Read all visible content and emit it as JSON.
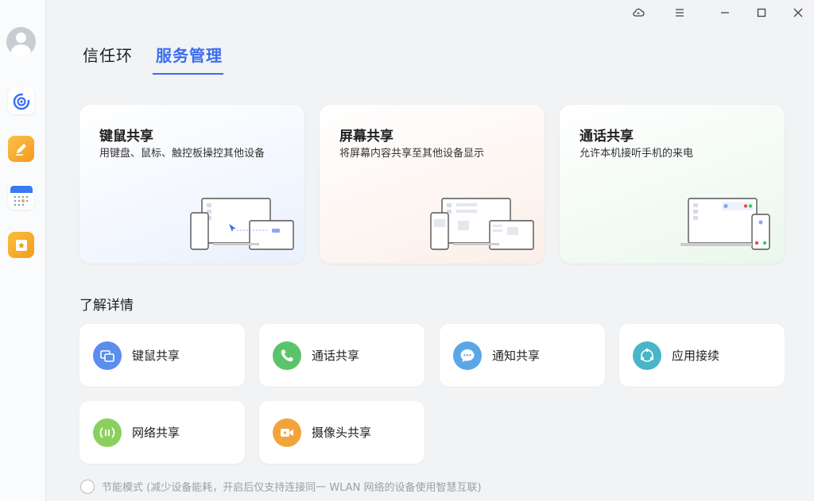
{
  "tabs": [
    {
      "label": "信任环",
      "active": false
    },
    {
      "label": "服务管理",
      "active": true
    }
  ],
  "feature_cards": [
    {
      "title": "键鼠共享",
      "desc": "用键盘、鼠标、触控板操控其他设备",
      "bg": "#eaf1fd"
    },
    {
      "title": "屏幕共享",
      "desc": "将屏幕内容共享至其他设备显示",
      "bg": "#fbf1ec"
    },
    {
      "title": "通话共享",
      "desc": "允许本机接听手机的来电",
      "bg": "#eef8ef"
    }
  ],
  "section": {
    "title": "了解详情"
  },
  "detail_cards": [
    {
      "label": "键鼠共享",
      "icon": "keyboard-mouse-icon",
      "color": "#5b8def"
    },
    {
      "label": "通话共享",
      "icon": "phone-icon",
      "color": "#5ac46b"
    },
    {
      "label": "通知共享",
      "icon": "chat-bubble-icon",
      "color": "#5aa7e8"
    },
    {
      "label": "应用接续",
      "icon": "app-continue-icon",
      "color": "#49b5c8"
    },
    {
      "label": "网络共享",
      "icon": "network-icon",
      "color": "#8bd05e"
    },
    {
      "label": "摄像头共享",
      "icon": "camera-icon",
      "color": "#f2a43c"
    }
  ],
  "energy_saving": {
    "label": "节能模式 (减少设备能耗，开启后仅支持连接同一 WLAN 网络的设备使用智慧互联)",
    "checked": false
  },
  "sidebar": {
    "apps": [
      {
        "icon": "orbit-app-icon",
        "color": "#3b6ff2"
      },
      {
        "icon": "notes-app-icon",
        "color": "#f5a623"
      },
      {
        "icon": "calendar-app-icon",
        "color": "#3a7bf2"
      },
      {
        "icon": "favorites-app-icon",
        "color": "#f7a928"
      }
    ]
  },
  "window_controls": [
    "cloud-sync-icon",
    "menu-icon",
    "minimize-icon",
    "maximize-icon",
    "close-icon"
  ],
  "colors": {
    "accent": "#3a6df0"
  }
}
